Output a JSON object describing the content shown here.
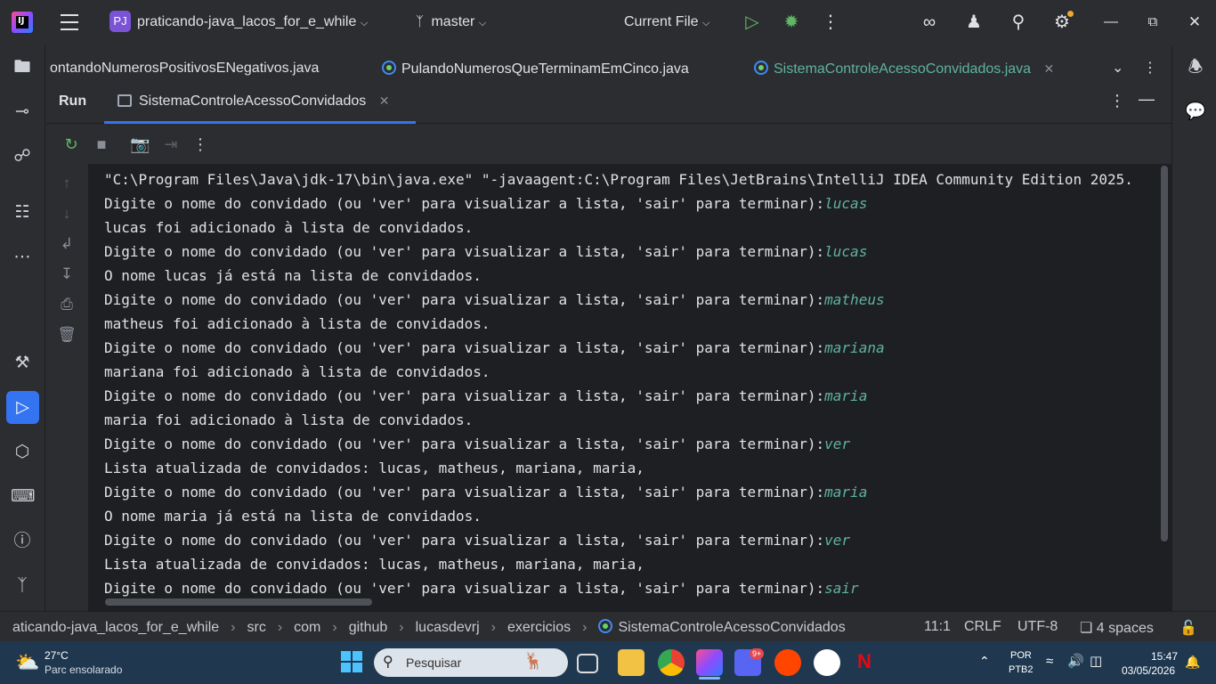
{
  "titlebar": {
    "app_logo_text": "IJ",
    "project_badge": "PJ",
    "project_name": "praticando-java_lacos_for_e_while",
    "branch": "master",
    "run_config": "Current File"
  },
  "editor_tabs": [
    {
      "label": "ontandoNumerosPositivosENegativos.java",
      "active": false
    },
    {
      "label": "PulandoNumerosQueTerminamEmCinco.java",
      "active": false
    },
    {
      "label": "SistemaControleAcessoConvidados.java",
      "active": true
    }
  ],
  "run_panel": {
    "title": "Run",
    "tab_label": "SistemaControleAcessoConvidados"
  },
  "console": {
    "command": "\"C:\\Program Files\\Java\\jdk-17\\bin\\java.exe\" \"-javaagent:C:\\Program Files\\JetBrains\\IntelliJ IDEA Community Edition 2025.",
    "prompt": "Digite o nome do convidado (ou 'ver' para visualizar a lista, 'sair' para terminar):",
    "lines": [
      {
        "type": "prompt",
        "input": "lucas"
      },
      {
        "type": "out",
        "text": "lucas foi adicionado à lista de convidados."
      },
      {
        "type": "prompt",
        "input": "lucas"
      },
      {
        "type": "out",
        "text": "O nome lucas já está na lista de convidados."
      },
      {
        "type": "prompt",
        "input": "matheus"
      },
      {
        "type": "out",
        "text": "matheus foi adicionado à lista de convidados."
      },
      {
        "type": "prompt",
        "input": "mariana"
      },
      {
        "type": "out",
        "text": "mariana foi adicionado à lista de convidados."
      },
      {
        "type": "prompt",
        "input": "maria"
      },
      {
        "type": "out",
        "text": "maria foi adicionado à lista de convidados."
      },
      {
        "type": "prompt",
        "input": "ver"
      },
      {
        "type": "out",
        "text": "Lista atualizada de convidados: lucas, matheus, mariana, maria,"
      },
      {
        "type": "prompt",
        "input": "maria"
      },
      {
        "type": "out",
        "text": "O nome maria já está na lista de convidados."
      },
      {
        "type": "prompt",
        "input": "ver"
      },
      {
        "type": "out",
        "text": "Lista atualizada de convidados: lucas, matheus, mariana, maria,"
      },
      {
        "type": "prompt",
        "input": "sair"
      }
    ]
  },
  "statusbar": {
    "breadcrumbs": [
      "aticando-java_lacos_for_e_while",
      "src",
      "com",
      "github",
      "lucasdevrj",
      "exercicios",
      "SistemaControleAcessoConvidados"
    ],
    "position": "11:1",
    "line_sep": "CRLF",
    "encoding": "UTF-8",
    "indent": "4 spaces"
  },
  "taskbar": {
    "weather_temp": "27°C",
    "weather_desc": "Parc ensolarado",
    "search_placeholder": "Pesquisar",
    "lang": "POR",
    "layout": "PTB2",
    "time": "15:47",
    "date": "03/05/2026",
    "discord_badge": "9+"
  },
  "colors": {
    "accent": "#3574f0",
    "console_bg": "#1e1f22",
    "input_text": "#5fb3a1",
    "run_green": "#5fb865"
  }
}
